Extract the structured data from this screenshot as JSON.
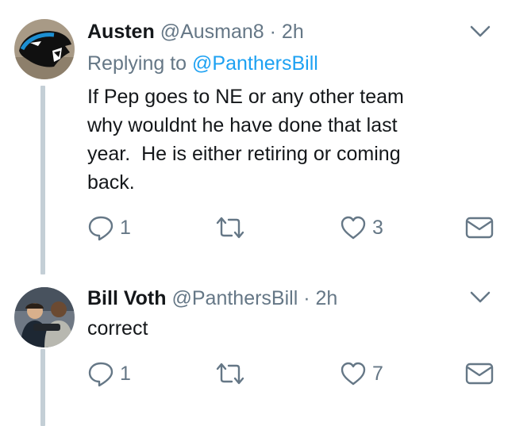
{
  "tweets": [
    {
      "name": "Austen",
      "handle": "@Ausman8",
      "separator": "·",
      "time": "2h",
      "replying_prefix": "Replying to ",
      "replying_mention": "@PanthersBill",
      "text_lines": [
        "If Pep goes to NE or any other team",
        "why wouldnt he have done that last",
        "year.  He is either retiring or coming",
        "back."
      ],
      "reply_count": "1",
      "retweet_count": "",
      "like_count": "3"
    },
    {
      "name": "Bill Voth",
      "handle": "@PanthersBill",
      "separator": "·",
      "time": "2h",
      "text_lines": [
        "correct"
      ],
      "reply_count": "1",
      "retweet_count": "",
      "like_count": "7"
    }
  ],
  "icons": {
    "reply": "reply-icon",
    "retweet": "retweet-icon",
    "like": "heart-icon",
    "dm": "direct-message-icon",
    "caret": "chevron-down-icon"
  },
  "colors": {
    "text": "#14171a",
    "secondary": "#657786",
    "accent": "#1da1f2",
    "thread_line": "#c4cfd6"
  }
}
